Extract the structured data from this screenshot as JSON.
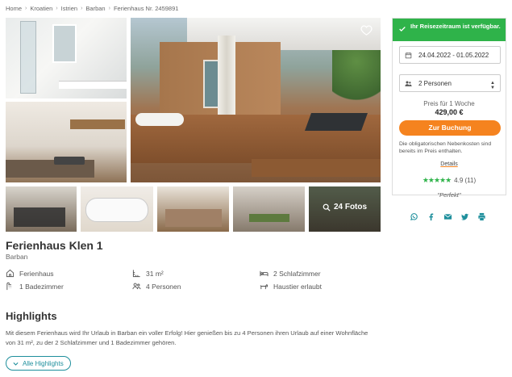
{
  "breadcrumb": [
    "Home",
    "Kroatien",
    "Istrien",
    "Barban",
    "Ferienhaus Nr. 2459891"
  ],
  "gallery": {
    "more_photos_label": "24 Fotos"
  },
  "booking": {
    "availability": "Ihr Reisezeitraum ist verfügbar.",
    "dates": "24.04.2022 - 01.05.2022",
    "guests": "2 Personen",
    "price_label": "Preis für 1 Woche",
    "price": "429,00 €",
    "book_button": "Zur Buchung",
    "note": "Die obligatorischen Nebenkosten sind bereits im Preis enthalten.",
    "details_link": "Details",
    "rating_value": "4.9 (11)",
    "rating_stars": 5,
    "quote": "\"Perfekt\""
  },
  "share_icons": [
    "whatsapp-icon",
    "facebook-icon",
    "email-icon",
    "twitter-icon",
    "print-icon"
  ],
  "listing": {
    "title": "Ferienhaus Klen 1",
    "location": "Barban",
    "facts": {
      "type": "Ferienhaus",
      "area": "31 m²",
      "bedrooms": "2 Schlafzimmer",
      "bathrooms": "1 Badezimmer",
      "persons": "4 Personen",
      "pets": "Haustier erlaubt"
    }
  },
  "highlights": {
    "heading": "Highlights",
    "text": "Mit diesem Ferienhaus wird Ihr Urlaub in Barban ein voller Erfolg! Hier genießen bis zu 4 Personen ihren Urlaub auf einer Wohnfläche von 31 m², zu der 2 Schlafzimmer und 1 Badezimmer gehören.",
    "all_button": "Alle Highlights"
  },
  "colors": {
    "accent_teal": "#1e8f9c",
    "available_green": "#2fb34a",
    "cta_orange": "#f5831f"
  }
}
